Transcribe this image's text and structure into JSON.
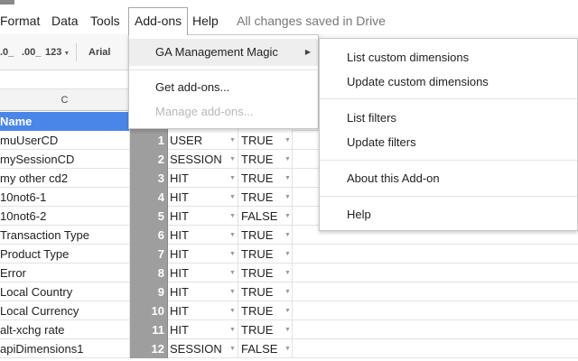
{
  "menubar": {
    "items": [
      "Format",
      "Data",
      "Tools",
      "Add-ons",
      "Help"
    ],
    "status": "All changes saved in Drive"
  },
  "toolbar": {
    "decimal_decrease": ".0_",
    "decimal_increase": ".00_",
    "number_format": "123",
    "font": "Arial"
  },
  "sheet": {
    "column_label": "C",
    "header": "Name",
    "rows": [
      {
        "name": "muUserCD",
        "num": "1",
        "type": "USER",
        "flag": "TRUE"
      },
      {
        "name": "mySessionCD",
        "num": "2",
        "type": "SESSION",
        "flag": "TRUE"
      },
      {
        "name": "my other cd2",
        "num": "3",
        "type": "HIT",
        "flag": "TRUE"
      },
      {
        "name": "10not6-1",
        "num": "4",
        "type": "HIT",
        "flag": "TRUE"
      },
      {
        "name": "10not6-2",
        "num": "5",
        "type": "HIT",
        "flag": "FALSE"
      },
      {
        "name": "Transaction Type",
        "num": "6",
        "type": "HIT",
        "flag": "TRUE"
      },
      {
        "name": "Product Type",
        "num": "7",
        "type": "HIT",
        "flag": "TRUE"
      },
      {
        "name": "Error",
        "num": "8",
        "type": "HIT",
        "flag": "TRUE"
      },
      {
        "name": "Local Country",
        "num": "9",
        "type": "HIT",
        "flag": "TRUE"
      },
      {
        "name": "Local Currency",
        "num": "10",
        "type": "HIT",
        "flag": "TRUE"
      },
      {
        "name": "alt-xchg rate",
        "num": "11",
        "type": "HIT",
        "flag": "TRUE"
      },
      {
        "name": "apiDimensions1",
        "num": "12",
        "type": "SESSION",
        "flag": "FALSE"
      }
    ]
  },
  "addons_menu": {
    "items": [
      "GA Management Magic",
      "Get add-ons...",
      "Manage add-ons..."
    ]
  },
  "submenu": {
    "items": [
      "List custom dimensions",
      "Update custom dimensions",
      "List filters",
      "Update filters",
      "About this Add-on",
      "Help"
    ]
  },
  "colors": {
    "header_blue": "#4a86e8",
    "index_gray": "#9e9e9e"
  }
}
